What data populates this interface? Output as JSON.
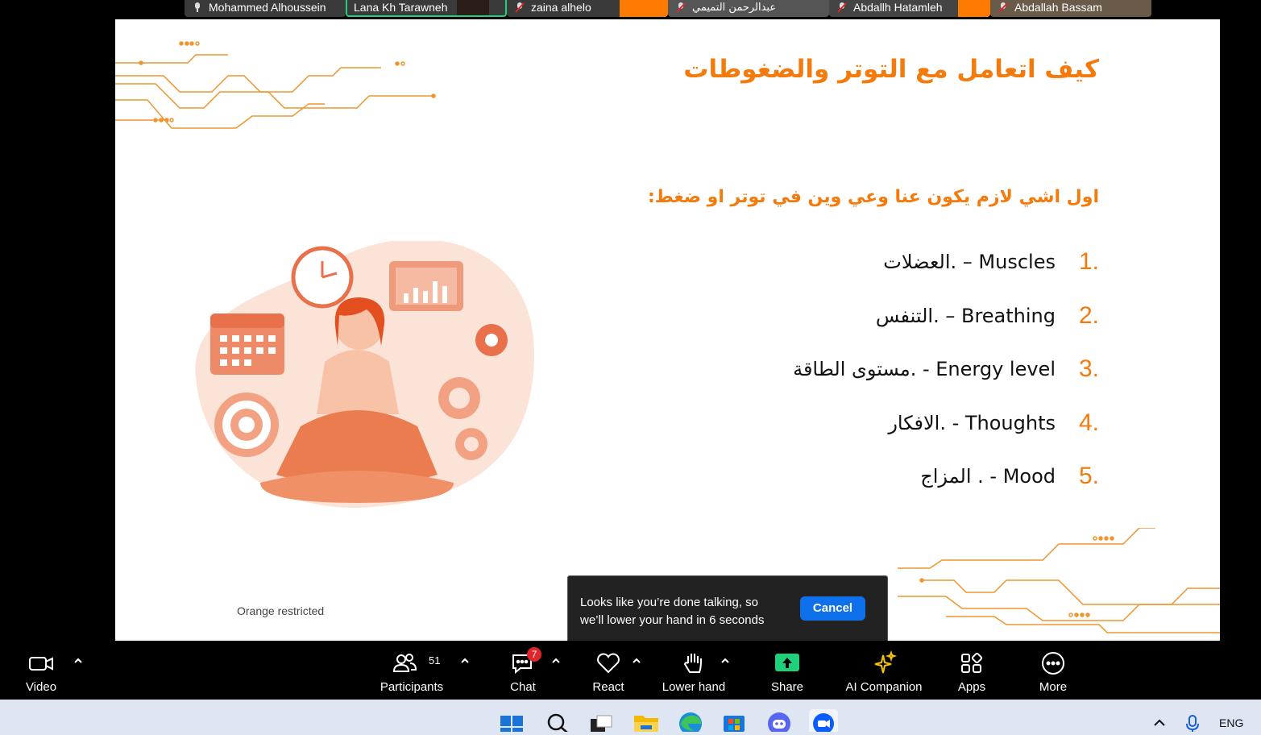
{
  "participants": [
    {
      "name": "Mohammed Alhoussein",
      "muted": false
    },
    {
      "name": "Lana Kh Tarawneh",
      "muted": false,
      "active": true
    },
    {
      "name": "zaina alhelo",
      "muted": true
    },
    {
      "name": "عبدالرحمن التميمي",
      "muted": true
    },
    {
      "name": "Abdallh Hatamleh",
      "muted": true
    },
    {
      "name": "Abdallah Bassam",
      "muted": true
    }
  ],
  "slide": {
    "title": "كيف اتعامل مع التوتر والضغوطات",
    "subtitle": "اول اشي لازم يكون عنا وعي وين في توتر او ضغط:",
    "items": [
      {
        "num": "1.",
        "text": "العضلات. – Muscles"
      },
      {
        "num": "2.",
        "text": "التنفس. – Breathing"
      },
      {
        "num": "3.",
        "text": "مستوى الطاقة. - Energy level"
      },
      {
        "num": "4.",
        "text": "الافكار. - Thoughts"
      },
      {
        "num": "5.",
        "text": "المزاج . - Mood"
      }
    ],
    "footer": "Orange restricted",
    "accent_color": "#f47a0c"
  },
  "toast": {
    "message": "Looks like you’re done talking, so we’ll lower your hand in 6 seconds",
    "cancel_label": "Cancel"
  },
  "toolbar": {
    "video": "Video",
    "participants": "Participants",
    "participants_count": "51",
    "chat": "Chat",
    "chat_badge": "7",
    "react": "React",
    "lower_hand": "Lower hand",
    "share": "Share",
    "ai_companion": "AI Companion",
    "apps": "Apps",
    "more": "More"
  },
  "taskbar": {
    "icons": [
      "windows-start-icon",
      "search-icon",
      "task-view-icon",
      "file-explorer-icon",
      "edge-icon",
      "microsoft-store-icon",
      "discord-icon",
      "zoom-icon"
    ],
    "language": "ENG"
  }
}
